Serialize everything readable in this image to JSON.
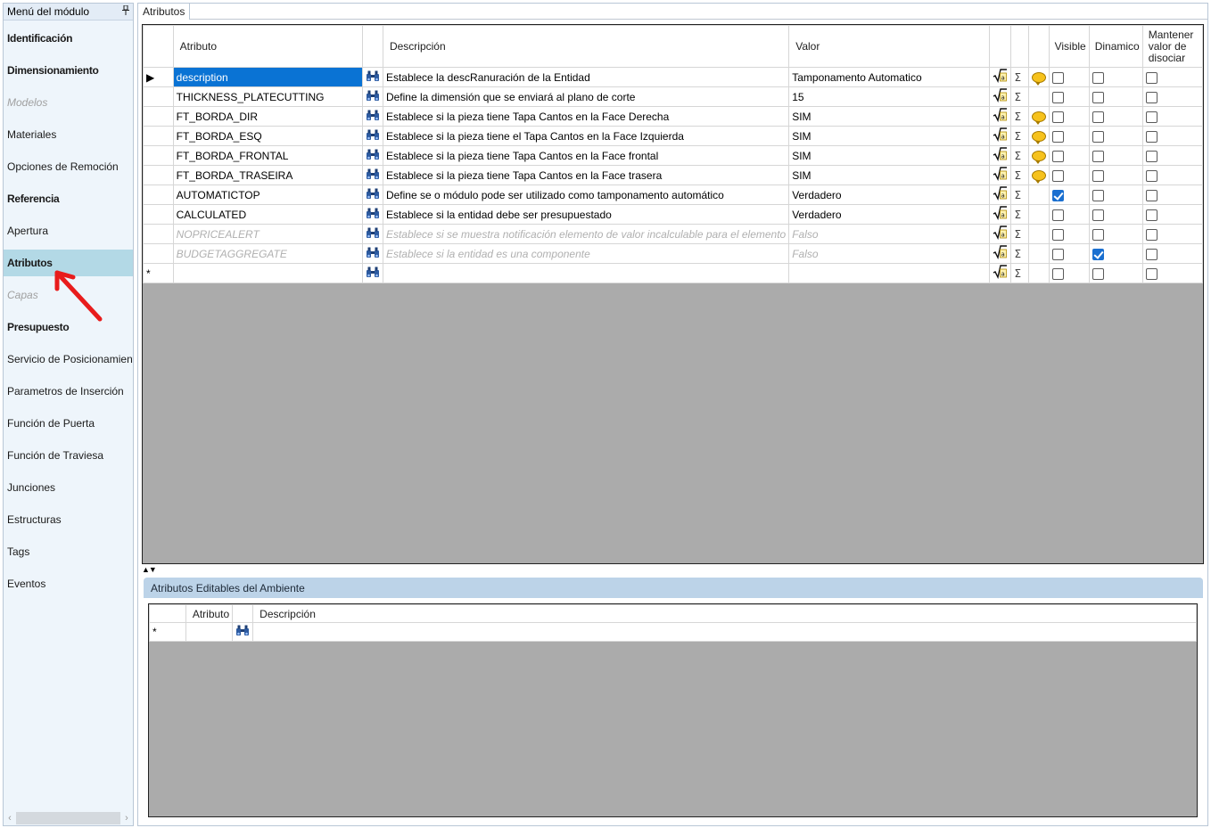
{
  "sidebar": {
    "title": "Menú del módulo",
    "pin_icon": "pin-icon",
    "items": [
      {
        "label": "Identificación",
        "style": "bold"
      },
      {
        "label": "Dimensionamiento",
        "style": "bold"
      },
      {
        "label": "Modelos",
        "style": "disabled"
      },
      {
        "label": "Materiales",
        "style": "normal"
      },
      {
        "label": "Opciones de Remoción",
        "style": "normal"
      },
      {
        "label": "Referencia",
        "style": "bold"
      },
      {
        "label": "Apertura",
        "style": "normal"
      },
      {
        "label": "Atributos",
        "style": "bold",
        "selected": true
      },
      {
        "label": "Capas",
        "style": "disabled"
      },
      {
        "label": "Presupuesto",
        "style": "bold"
      },
      {
        "label": "Servicio de Posicionamiento",
        "style": "normal"
      },
      {
        "label": "Parametros de Inserción",
        "style": "normal"
      },
      {
        "label": "Función de Puerta",
        "style": "normal"
      },
      {
        "label": "Función de Traviesa",
        "style": "normal"
      },
      {
        "label": "Junciones",
        "style": "normal"
      },
      {
        "label": "Estructuras",
        "style": "normal"
      },
      {
        "label": "Tags",
        "style": "normal"
      },
      {
        "label": "Eventos",
        "style": "normal"
      }
    ]
  },
  "tabs": {
    "active": "Atributos"
  },
  "grid": {
    "columns": {
      "atributo": "Atributo",
      "descripcion": "Descripción",
      "valor": "Valor",
      "visible": "Visible",
      "dinamico": "Dinamico",
      "mantener": "Mantener valor de disociar"
    },
    "rows": [
      {
        "atributo": "description",
        "descripcion": "Establece la descRanuración de la Entidad",
        "valor": "Tamponamento Automatico",
        "bubble": true,
        "visible": false,
        "dinamico": false,
        "mantener": false,
        "selected": true,
        "disabled": false
      },
      {
        "atributo": "THICKNESS_PLATECUTTING",
        "descripcion": "Define la dimensión que se enviará al plano de corte",
        "valor": "15",
        "bubble": false,
        "visible": false,
        "dinamico": false,
        "mantener": false,
        "selected": false,
        "disabled": false
      },
      {
        "atributo": "FT_BORDA_DIR",
        "descripcion": "Establece si la pieza tiene Tapa Cantos en la Face Derecha",
        "valor": "SIM",
        "bubble": true,
        "visible": false,
        "dinamico": false,
        "mantener": false,
        "selected": false,
        "disabled": false
      },
      {
        "atributo": "FT_BORDA_ESQ",
        "descripcion": "Establece si la pieza tiene el Tapa Cantos en la Face Izquierda",
        "valor": "SIM",
        "bubble": true,
        "visible": false,
        "dinamico": false,
        "mantener": false,
        "selected": false,
        "disabled": false
      },
      {
        "atributo": "FT_BORDA_FRONTAL",
        "descripcion": "Establece si la pieza tiene Tapa Cantos en la Face frontal",
        "valor": "SIM",
        "bubble": true,
        "visible": false,
        "dinamico": false,
        "mantener": false,
        "selected": false,
        "disabled": false
      },
      {
        "atributo": "FT_BORDA_TRASEIRA",
        "descripcion": "Establece si la pieza tiene Tapa Cantos en la Face trasera",
        "valor": "SIM",
        "bubble": true,
        "visible": false,
        "dinamico": false,
        "mantener": false,
        "selected": false,
        "disabled": false
      },
      {
        "atributo": "AUTOMATICTOP",
        "descripcion": "Define se o módulo pode ser utilizado como tamponamento automático",
        "valor": "Verdadero",
        "bubble": false,
        "visible": true,
        "dinamico": false,
        "mantener": false,
        "selected": false,
        "disabled": false
      },
      {
        "atributo": "CALCULATED",
        "descripcion": "Establece si la entidad debe ser presupuestado",
        "valor": "Verdadero",
        "bubble": false,
        "visible": false,
        "dinamico": false,
        "mantener": false,
        "selected": false,
        "disabled": false
      },
      {
        "atributo": "NOPRICEALERT",
        "descripcion": "Establece si se muestra notificación elemento de valor incalculable para el elemento",
        "valor": "Falso",
        "bubble": false,
        "visible": false,
        "dinamico": false,
        "mantener": false,
        "selected": false,
        "disabled": true
      },
      {
        "atributo": "BUDGETAGGREGATE",
        "descripcion": "Establece si la entidad es una componente",
        "valor": "Falso",
        "bubble": false,
        "visible": false,
        "dinamico": true,
        "mantener": false,
        "selected": false,
        "disabled": true
      }
    ],
    "new_row_marker": "*",
    "current_row_marker": "▶"
  },
  "splitter_label": "▲▼",
  "env": {
    "title": "Atributos Editables del Ambiente",
    "columns": {
      "atributo": "Atributo",
      "descripcion": "Descripción"
    },
    "new_row_marker": "*"
  },
  "colors": {
    "selection": "#0a73d4",
    "sidebar_selected": "#b3d9e6",
    "sidebar_bg": "#eef5fb",
    "grid_empty": "#ababab",
    "env_header": "#bcd3e8",
    "checkbox_checked": "#1a6fd0"
  }
}
